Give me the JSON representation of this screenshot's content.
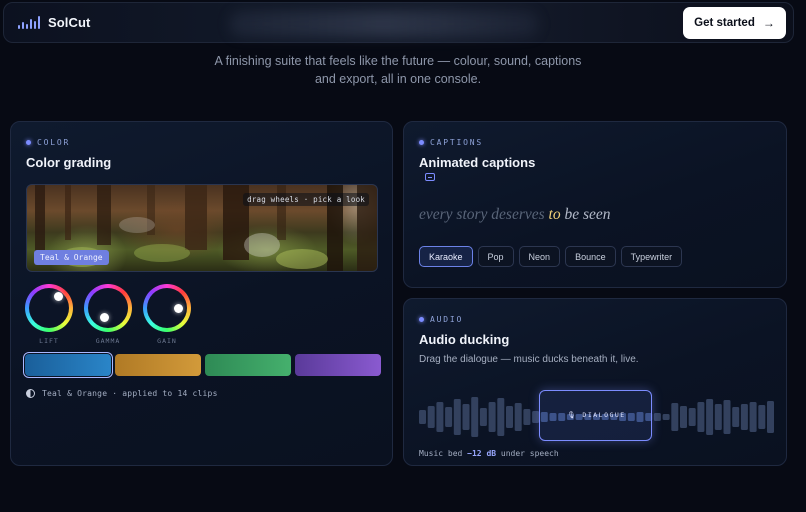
{
  "nav": {
    "brand": "SolCut",
    "cta_label": "Get started",
    "cta_icon": "arrow-right-icon"
  },
  "tagline": {
    "line1": "A finishing suite that feels like the future — colour, sound, captions",
    "line2": "and export, all in one console."
  },
  "color": {
    "eyebrow": "COLOR",
    "title": "Color grading",
    "preview_hint": "drag wheels · pick a look",
    "preview_badge": "Teal & Orange",
    "wheels": [
      {
        "label": "LIFT"
      },
      {
        "label": "GAMMA"
      },
      {
        "label": "GAIN"
      }
    ],
    "looks": [
      {
        "name": "teal",
        "from": "#1a5f9a",
        "to": "#2a85c8",
        "active": true
      },
      {
        "name": "orange",
        "from": "#b07a25",
        "to": "#d29a3a",
        "active": false
      },
      {
        "name": "green",
        "from": "#2e8a55",
        "to": "#45b06d",
        "active": false
      },
      {
        "name": "purple",
        "from": "#5a3a9a",
        "to": "#8a5ad0",
        "active": false
      }
    ],
    "applied_look": "Teal & Orange",
    "applied_suffix": "· applied to 14 clips"
  },
  "captions": {
    "eyebrow": "CAPTIONS",
    "title": "Animated captions",
    "line_before": "every story deserves ",
    "line_highlight": "to",
    "line_after": " be seen",
    "styles": [
      "Karaoke",
      "Pop",
      "Neon",
      "Bounce",
      "Typewriter"
    ],
    "active_style": "Karaoke"
  },
  "audio": {
    "eyebrow": "AUDIO",
    "title": "Audio ducking",
    "description": "Drag the dialogue — music ducks beneath it, live.",
    "dialogue_label": "🎙 DIALOGUE",
    "foot_prefix": "Music bed ",
    "foot_db": "−12 dB",
    "foot_suffix": " under speech"
  },
  "colors": {
    "accent": "#7c8cff",
    "background": "#070a14",
    "highlight": "#f2d27a"
  }
}
